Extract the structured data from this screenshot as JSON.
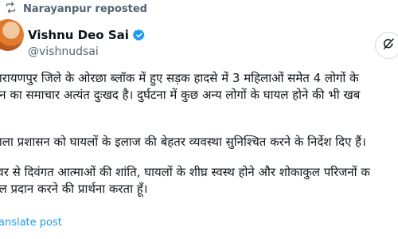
{
  "repost": {
    "label": "Narayanpur reposted",
    "icon": "repost-icon"
  },
  "author": {
    "name": "Vishnu Deo Sai",
    "handle": "@vishnudsai",
    "verified_color": "#1d9bf0"
  },
  "post": {
    "lines": [
      "ारायणपुर जिले के ओरछा ब्लॉक में हुए सड़क हादसे में 3 महिलाओं समेत 4 लोगों के",
      "धन का समाचार अत्यंत दुःखद है। दुर्घटना में कुछ अन्य लोगों के घायल होने की भी खब",
      "।",
      "",
      "ाला प्रशासन को घायलों के इलाज की बेहतर व्यवस्था सुनिश्चित करने के निर्देश दिए हैं।",
      "",
      "श्वर से दिवंगत आत्माओं की शांति, घायलों के शीघ्र स्वस्थ होने और शोकाकुल परिजनों क",
      "बल प्रदान करने की प्रार्थना करता हूँ।"
    ]
  },
  "translate_label": "anslate post",
  "colors": {
    "accent": "#1d9bf0",
    "muted": "#536471",
    "text": "#0f1419"
  }
}
